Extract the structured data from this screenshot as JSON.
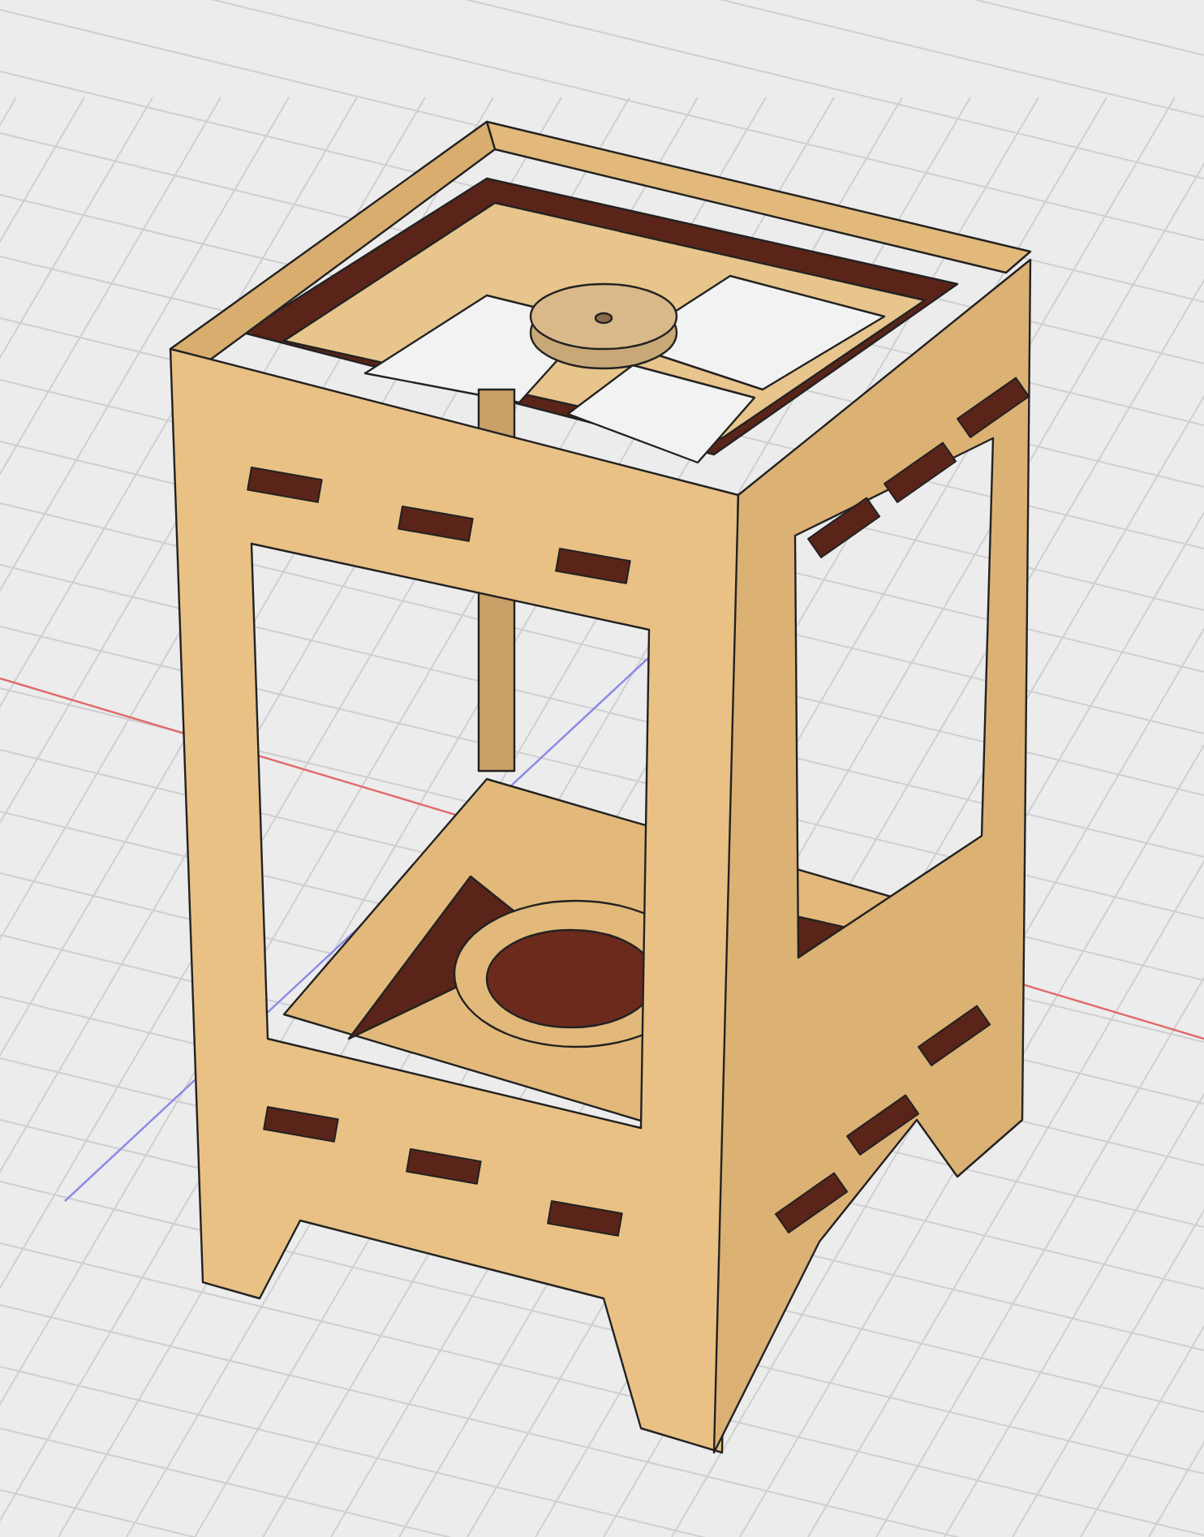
{
  "viewport": {
    "grid": true,
    "axes": [
      {
        "kind": "x",
        "color": "#e06a6a"
      },
      {
        "kind": "z",
        "color": "#8a8ae6"
      }
    ]
  }
}
